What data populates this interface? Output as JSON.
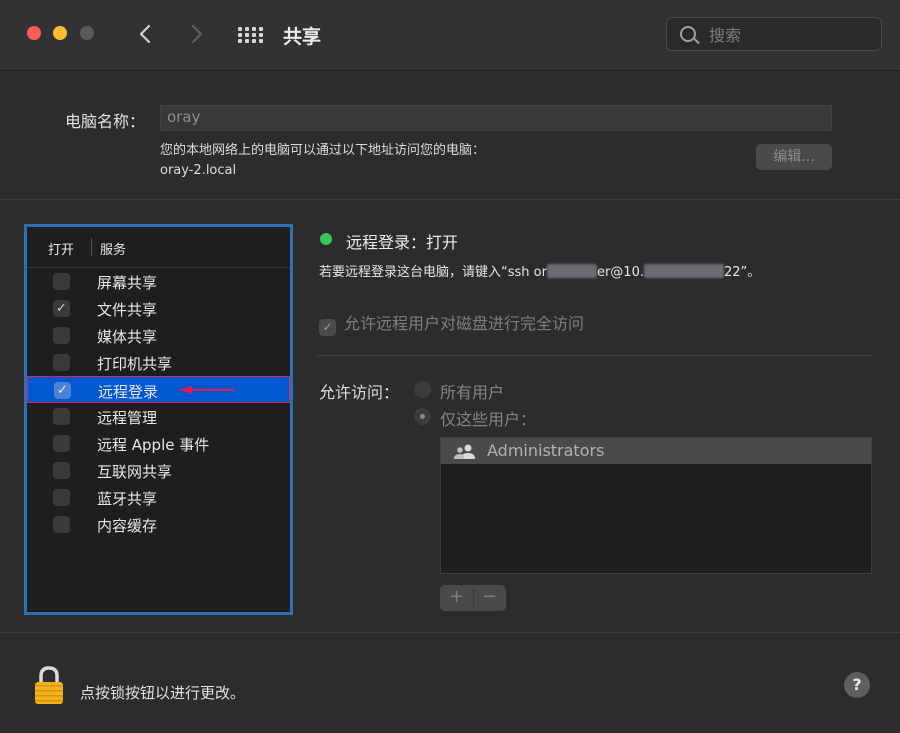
{
  "window": {
    "title": "共享"
  },
  "search": {
    "placeholder": "搜索"
  },
  "computer_name": {
    "label": "电脑名称：",
    "value": "oray",
    "description_line1": "您的本地网络上的电脑可以通过以下地址访问您的电脑：",
    "description_line2": "oray-2.local",
    "edit_label": "编辑..."
  },
  "services": {
    "header_on": "打开",
    "header_service": "服务",
    "items": [
      {
        "label": "屏幕共享",
        "checked": false
      },
      {
        "label": "文件共享",
        "checked": true
      },
      {
        "label": "媒体共享",
        "checked": false
      },
      {
        "label": "打印机共享",
        "checked": false
      },
      {
        "label": "远程登录",
        "checked": true,
        "selected": true
      },
      {
        "label": "远程管理",
        "checked": false
      },
      {
        "label": "远程 Apple 事件",
        "checked": false
      },
      {
        "label": "互联网共享",
        "checked": false
      },
      {
        "label": "蓝牙共享",
        "checked": false
      },
      {
        "label": "内容缓存",
        "checked": false
      }
    ]
  },
  "detail": {
    "status": "远程登录：打开",
    "hint_prefix": "若要远程登录这台电脑，请键入“ssh or",
    "hint_mid1": "er@10.",
    "hint_suffix": "22”。",
    "full_access_label": "允许远程用户对磁盘进行完全访问",
    "allow_access_label": "允许访问：",
    "radio_all": "所有用户",
    "radio_only": "仅这些用户：",
    "users": [
      "Administrators"
    ],
    "add_label": "+",
    "remove_label": "−"
  },
  "footer": {
    "lock_text": "点按锁按钮以进行更改。",
    "help_label": "?"
  },
  "colors": {
    "accent": "#0058d0",
    "status_on": "#35c759",
    "highlight_border": "#2d6fb0",
    "annotation_arrow": "#e0185a"
  }
}
